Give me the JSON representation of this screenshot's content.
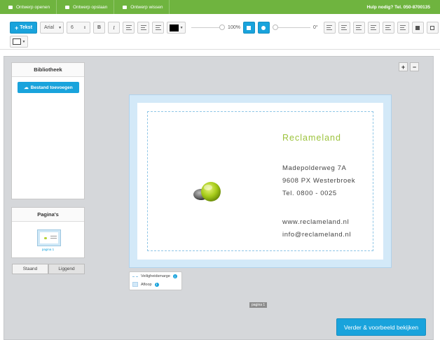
{
  "topbar": {
    "open_label": "Ontwerp openen",
    "save_label": "Ontwerp opslaan",
    "clear_label": "Ontwerp wissen",
    "help_text": "Hulp nodig? Tel. 050-8700135"
  },
  "toolbar": {
    "add_text_label": "Tekst",
    "font_family": "Arial",
    "font_size": "6",
    "bold_label": "B",
    "italic_label": "I",
    "opacity_value": "100%",
    "rotation_value": "0°"
  },
  "library": {
    "title": "Bibliotheek",
    "upload_label": "Bestand toevoegen"
  },
  "pages": {
    "title": "Pagina's",
    "thumb_caption": "pagina 1"
  },
  "orientation": {
    "portrait_label": "Staand",
    "landscape_label": "Liggend"
  },
  "card": {
    "brand": "Reclameland",
    "address_line1": "Madepolderweg 7A",
    "address_line2": "9608 PX Westerbroek",
    "phone": "Tel. 0800 - 0025",
    "website": "www.reclameland.nl",
    "email": "info@reclameland.nl"
  },
  "legend": {
    "safety_margin_label": "Veiligheidsmarge",
    "bleed_label": "Afloop"
  },
  "canvas_page_label": "pagina 1",
  "next_button_label": "Verder & voorbeeld bekijken",
  "colors": {
    "topbar": "#6fb43f",
    "accent": "#19a3dc",
    "brand_green": "#9cc33c"
  }
}
